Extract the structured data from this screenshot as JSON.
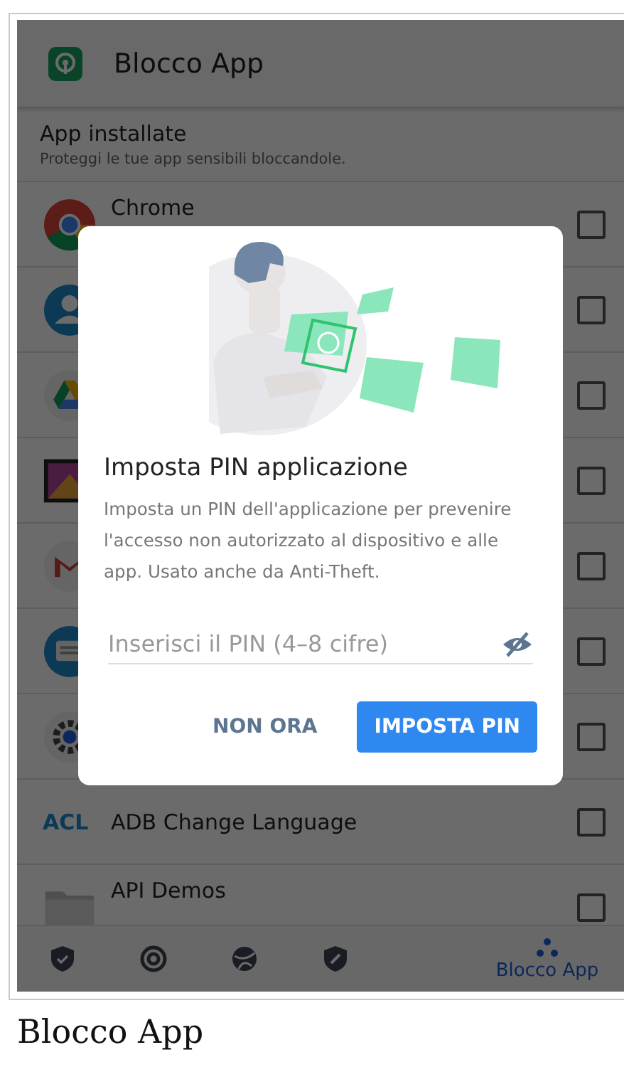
{
  "app_bar": {
    "title": "Blocco App"
  },
  "section": {
    "title": "App installate",
    "subtitle": "Proteggi le tue app sensibili bloccandole."
  },
  "apps": [
    {
      "kind": "icon",
      "name": "Chrome",
      "checked": false
    },
    {
      "kind": "icon",
      "checked": false
    },
    {
      "kind": "icon",
      "checked": false
    },
    {
      "kind": "icon",
      "checked": false
    },
    {
      "kind": "icon",
      "checked": false
    },
    {
      "kind": "icon",
      "checked": false
    },
    {
      "kind": "icon",
      "checked": false
    },
    {
      "kind": "badge",
      "badge": "ACL",
      "name": "ADB Change Language",
      "checked": false
    },
    {
      "kind": "icon",
      "name": "API Demos",
      "checked": false
    }
  ],
  "dialog": {
    "title": "Imposta PIN applicazione",
    "body": "Imposta un PIN dell'applicazione per prevenire l'accesso non autorizzato al dispositivo e alle app. Usato anche da Anti-Theft.",
    "field": {
      "placeholder": "Inserisci il PIN (4–8 cifre)"
    },
    "buttons": [
      {
        "label": "NON ORA",
        "kind": "text"
      },
      {
        "label": "IMPOSTA PIN",
        "kind": "primary"
      }
    ]
  },
  "bottom_nav": [
    {
      "selected": false
    },
    {
      "selected": false
    },
    {
      "selected": false
    },
    {
      "selected": false
    },
    {
      "label": "Blocco App",
      "selected": true
    }
  ],
  "caption": "Blocco App"
}
